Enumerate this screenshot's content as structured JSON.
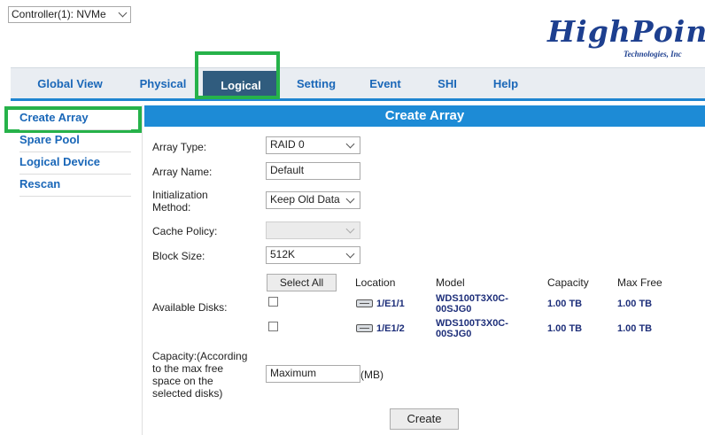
{
  "controller": {
    "selected": "Controller(1): NVMe"
  },
  "logo": {
    "main": "HighPoint",
    "sub": "Technologies, Inc"
  },
  "nav": {
    "tabs": [
      {
        "label": "Global View"
      },
      {
        "label": "Physical"
      },
      {
        "label": "Logical",
        "active": true
      },
      {
        "label": "Setting"
      },
      {
        "label": "Event"
      },
      {
        "label": "SHI"
      },
      {
        "label": "Help"
      }
    ]
  },
  "sidebar": {
    "items": [
      {
        "label": "Create Array",
        "active": true
      },
      {
        "label": "Spare Pool"
      },
      {
        "label": "Logical Device"
      },
      {
        "label": "Rescan"
      }
    ]
  },
  "main": {
    "title": "Create Array",
    "form": {
      "array_type_label": "Array Type:",
      "array_type_value": "RAID 0",
      "array_name_label": "Array Name:",
      "array_name_value": "Default",
      "init_label_1": "Initialization",
      "init_label_2": "Method:",
      "init_value": "Keep Old Data",
      "cache_label": "Cache Policy:",
      "cache_value": "",
      "block_label": "Block Size:",
      "block_value": "512K",
      "available_label": "Available Disks:",
      "select_all_label": "Select All",
      "capacity_label_1": "Capacity:(According",
      "capacity_label_2": "to the max free",
      "capacity_label_3": "space on the",
      "capacity_label_4": "selected disks)",
      "capacity_value": "Maximum",
      "capacity_unit": "(MB)",
      "create_label": "Create"
    },
    "disk_table": {
      "headers": {
        "location": "Location",
        "model": "Model",
        "capacity": "Capacity",
        "max_free": "Max Free"
      },
      "rows": [
        {
          "location": "1/E1/1",
          "model_1": "WDS100T3X0C-",
          "model_2": "00SJG0",
          "capacity": "1.00 TB",
          "max_free": "1.00 TB",
          "checked": false
        },
        {
          "location": "1/E1/2",
          "model_1": "WDS100T3X0C-",
          "model_2": "00SJG0",
          "capacity": "1.00 TB",
          "max_free": "1.00 TB",
          "checked": false
        }
      ]
    }
  },
  "colors": {
    "highlight_box": "#26b24a",
    "header_blue": "#1d8bd6",
    "active_tab": "#305c7e",
    "link_blue": "#1a67b8"
  }
}
